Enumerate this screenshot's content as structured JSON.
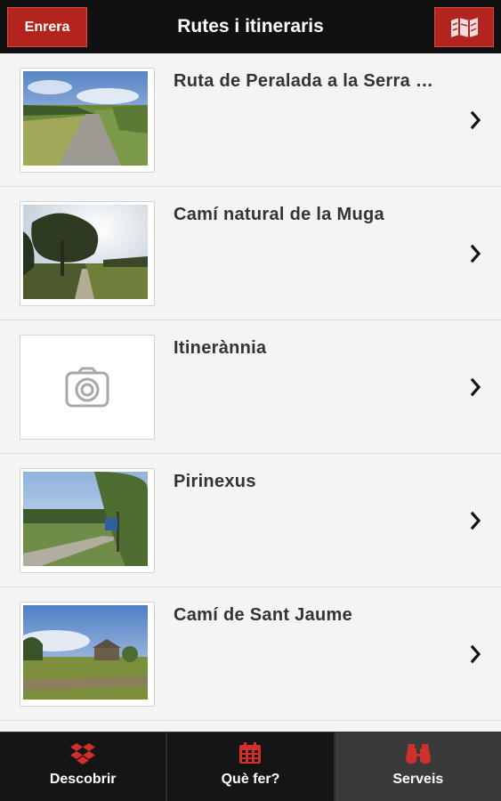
{
  "header": {
    "back_label": "Enrera",
    "title": "Rutes i itineraris",
    "map_icon": "map-icon"
  },
  "routes": [
    {
      "title": "Ruta de Peralada a la Serra …",
      "thumb": "path-through-fields-photo"
    },
    {
      "title": "Camí natural de la Muga",
      "thumb": "tree-lined-path-photo"
    },
    {
      "title": "Itinerànnia",
      "thumb": "camera-placeholder-icon"
    },
    {
      "title": "Pirinexus",
      "thumb": "road-along-trees-photo"
    },
    {
      "title": "Camí de Sant Jaume",
      "thumb": "rural-church-field-photo"
    }
  ],
  "tabbar": {
    "tabs": [
      {
        "label": "Descobrir",
        "icon": "dropbox-icon",
        "active": false
      },
      {
        "label": "Què fer?",
        "icon": "calendar-icon",
        "active": false
      },
      {
        "label": "Serveis",
        "icon": "binoculars-icon",
        "active": true
      }
    ]
  },
  "colors": {
    "accent": "#b3241f",
    "header_bg": "#111111",
    "list_bg": "#f4f4f4",
    "tab_active_bg": "#3a3a3a"
  }
}
